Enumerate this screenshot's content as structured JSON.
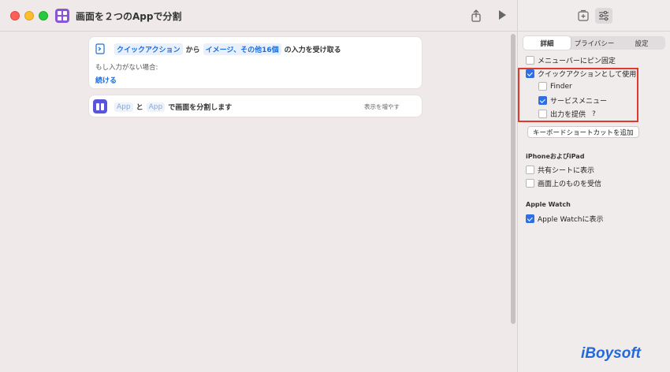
{
  "window": {
    "title": "画面を２つのAppで分割"
  },
  "editor": {
    "card1": {
      "token_quick_action": "クイックアクション",
      "from_text": "から",
      "token_inputs": "イメージ、その他16個",
      "receive_text": "の入力を受け取る",
      "if_none": "もし入力がない場合:",
      "continue_label": "続ける"
    },
    "card2": {
      "token_app1": "App",
      "and_text": "と",
      "token_app2": "App",
      "action_text": "で画面を分割します",
      "show_more": "表示を増やす"
    }
  },
  "panel": {
    "tabs": [
      "詳細",
      "プライバシー",
      "設定"
    ],
    "active_tab": "詳細",
    "options": {
      "pin_menubar": {
        "label": "メニューバーにピン固定",
        "checked": false
      },
      "use_quick_action": {
        "label": "クイックアクションとして使用",
        "checked": true
      },
      "finder": {
        "label": "Finder",
        "checked": false
      },
      "services_menu": {
        "label": "サービスメニュー",
        "checked": true
      },
      "provide_output": {
        "label": "出力を提供",
        "checked": false,
        "help": "?"
      }
    },
    "keyboard_shortcut_button": "キーボードショートカットを追加",
    "iphone_section": {
      "title": "iPhoneおよびiPad",
      "show_in_share_sheet": {
        "label": "共有シートに表示",
        "checked": false
      },
      "receive_onscreen": {
        "label": "画面上のものを受信",
        "checked": false
      }
    },
    "watch_section": {
      "title": "Apple Watch",
      "show_on_watch": {
        "label": "Apple Watchに表示",
        "checked": true
      }
    }
  },
  "watermark": "iBoysoft",
  "colors": {
    "accent": "#2f6fe4",
    "highlight_box": "#e03a2c",
    "app_icon": "#8a56d6",
    "action_icon": "#5a55d8",
    "watermark": "#2469d8"
  }
}
